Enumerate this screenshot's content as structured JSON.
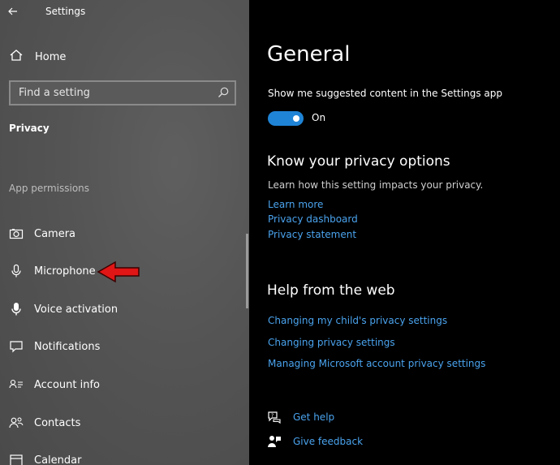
{
  "window": {
    "title": "Settings"
  },
  "sidebar": {
    "home_label": "Home",
    "search_placeholder": "Find a setting",
    "section_title": "Privacy",
    "group_title": "App permissions",
    "items": [
      {
        "label": "Camera",
        "icon": "camera-icon"
      },
      {
        "label": "Microphone",
        "icon": "microphone-icon"
      },
      {
        "label": "Voice activation",
        "icon": "voice-activation-icon"
      },
      {
        "label": "Notifications",
        "icon": "notifications-icon"
      },
      {
        "label": "Account info",
        "icon": "account-info-icon"
      },
      {
        "label": "Contacts",
        "icon": "contacts-icon"
      },
      {
        "label": "Calendar",
        "icon": "calendar-icon"
      }
    ]
  },
  "main": {
    "title": "General",
    "suggested": {
      "description": "Show me suggested content in the Settings app",
      "state_label": "On"
    },
    "privacy_options": {
      "heading": "Know your privacy options",
      "text": "Learn how this setting impacts your privacy.",
      "links": [
        "Learn more",
        "Privacy dashboard",
        "Privacy statement"
      ]
    },
    "help_web": {
      "heading": "Help from the web",
      "links": [
        "Changing my child's privacy settings",
        "Changing privacy settings",
        "Managing Microsoft account privacy settings"
      ]
    },
    "support": {
      "get_help": "Get help",
      "give_feedback": "Give feedback"
    }
  },
  "colors": {
    "accent": "#1f84d6",
    "link": "#4aa3ee",
    "annotation_arrow": "#e01515"
  }
}
